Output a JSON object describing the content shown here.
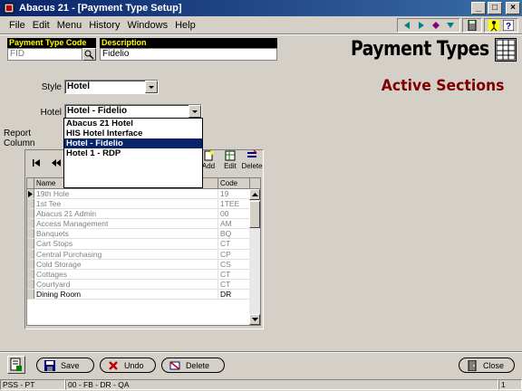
{
  "window": {
    "title": "Abacus 21 - [Payment Type Setup]"
  },
  "menu": [
    "File",
    "Edit",
    "Menu",
    "History",
    "Windows",
    "Help"
  ],
  "header": {
    "code_label": "Payment Type Code",
    "code_value": "FID",
    "desc_label": "Description",
    "desc_value": "Fidelio",
    "page_title": "Payment Types"
  },
  "sections_title": "Active Sections",
  "form": {
    "style_label": "Style",
    "style_value": "Hotel",
    "hotel_label": "Hotel",
    "hotel_value": "Hotel - Fidelio",
    "report_label": "Report Column"
  },
  "hotel_options": [
    "Abacus 21 Hotel",
    "HIS Hotel Interface",
    "Hotel - Fidelio",
    "Hotel 1 - RDP"
  ],
  "hotel_selected_index": 2,
  "toolbar": {
    "add": "Add",
    "edit": "Edit",
    "delete": "Delete"
  },
  "grid": {
    "columns": [
      "Name",
      "Code"
    ],
    "rows": [
      {
        "name": "19th Hole",
        "code": "19"
      },
      {
        "name": "1st Tee",
        "code": "1TEE"
      },
      {
        "name": "Abacus 21 Admin",
        "code": "00"
      },
      {
        "name": "Access Management",
        "code": "AM"
      },
      {
        "name": "Banquets",
        "code": "BQ"
      },
      {
        "name": "Cart Stops",
        "code": "CT"
      },
      {
        "name": "Central Purchasing",
        "code": "CP"
      },
      {
        "name": "Cold Storage",
        "code": "CS"
      },
      {
        "name": "Cottages",
        "code": "CT"
      },
      {
        "name": "Courtyard",
        "code": "CT"
      },
      {
        "name": "Dining Room",
        "code": "DR"
      }
    ]
  },
  "buttons": {
    "save": "Save",
    "undo": "Undo",
    "delete": "Delete",
    "close": "Close"
  },
  "status": {
    "left": "PSS - PT",
    "middle": "00 - FB - DR - QA",
    "right": "1"
  }
}
